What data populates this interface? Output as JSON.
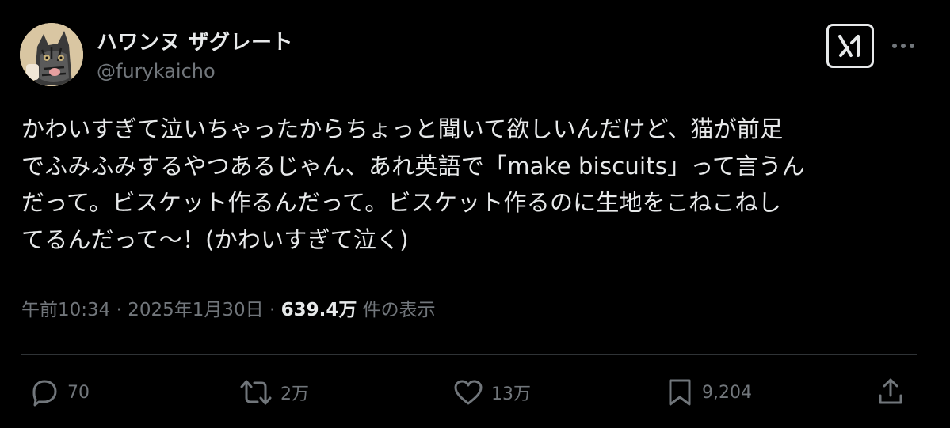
{
  "user": {
    "display_name": "ハワンヌ ザグレート",
    "handle": "@furykaicho",
    "avatar_icon": "cat-avatar-icon"
  },
  "header": {
    "grok_icon": "grok-icon",
    "more_icon": "more-horizontal-icon"
  },
  "tweet": {
    "text": "かわいすぎて泣いちゃったからちょっと聞いて欲しいんだけど、猫が前足\nでふみふみするやつあるじゃん、あれ英語で「make biscuits」って言うん\nだって。ビスケット作るんだって。ビスケット作るのに生地をこねこねし\nてるんだって〜！(かわいすぎて泣く)"
  },
  "meta": {
    "time": "午前10:34",
    "separator1": " · ",
    "date": "2025年1月30日",
    "separator2": " · ",
    "views_count": "639.4万",
    "views_label": " 件の表示"
  },
  "actions": {
    "reply": {
      "icon": "reply-icon",
      "count": "70"
    },
    "retweet": {
      "icon": "retweet-icon",
      "count": "2万"
    },
    "like": {
      "icon": "heart-icon",
      "count": "13万"
    },
    "bookmark": {
      "icon": "bookmark-icon",
      "count": "9,204"
    },
    "share": {
      "icon": "share-icon"
    }
  },
  "colors": {
    "background": "#000000",
    "text_primary": "#e7e9ea",
    "text_secondary": "#71767b",
    "divider": "#2f3336"
  }
}
